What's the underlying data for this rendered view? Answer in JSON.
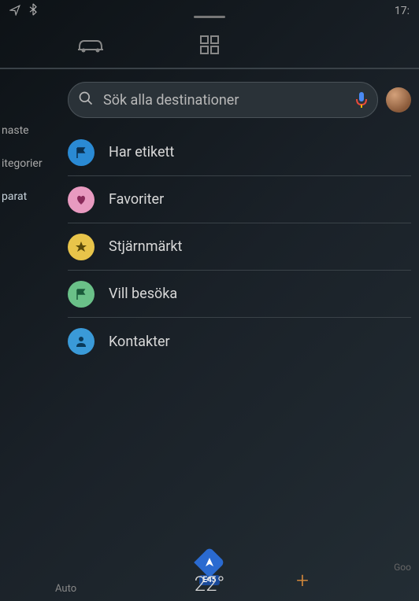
{
  "status": {
    "time": "17:"
  },
  "search": {
    "placeholder": "Sök alla destinationer"
  },
  "sidebar": {
    "items": [
      {
        "label": "naste"
      },
      {
        "label": "itegorier"
      },
      {
        "label": "parat"
      }
    ],
    "active_index": 2
  },
  "list": {
    "items": [
      {
        "label": "Har etikett",
        "icon": "flag",
        "bg": "#2a8ad4",
        "fg": "#0a3050"
      },
      {
        "label": "Favoriter",
        "icon": "heart",
        "bg": "#e89ac0",
        "fg": "#8a2a5a"
      },
      {
        "label": "Stjärnmärkt",
        "icon": "star",
        "bg": "#e8c44a",
        "fg": "#5a4a0a"
      },
      {
        "label": "Vill besöka",
        "icon": "flag",
        "bg": "#6ac088",
        "fg": "#1a5a3a"
      },
      {
        "label": "Kontakter",
        "icon": "person",
        "bg": "#3a9ad8",
        "fg": "#0a3a5a"
      }
    ]
  },
  "bottom": {
    "auto_label": "Auto",
    "temperature": "22°",
    "road": "E45",
    "attribution": "Goo"
  }
}
